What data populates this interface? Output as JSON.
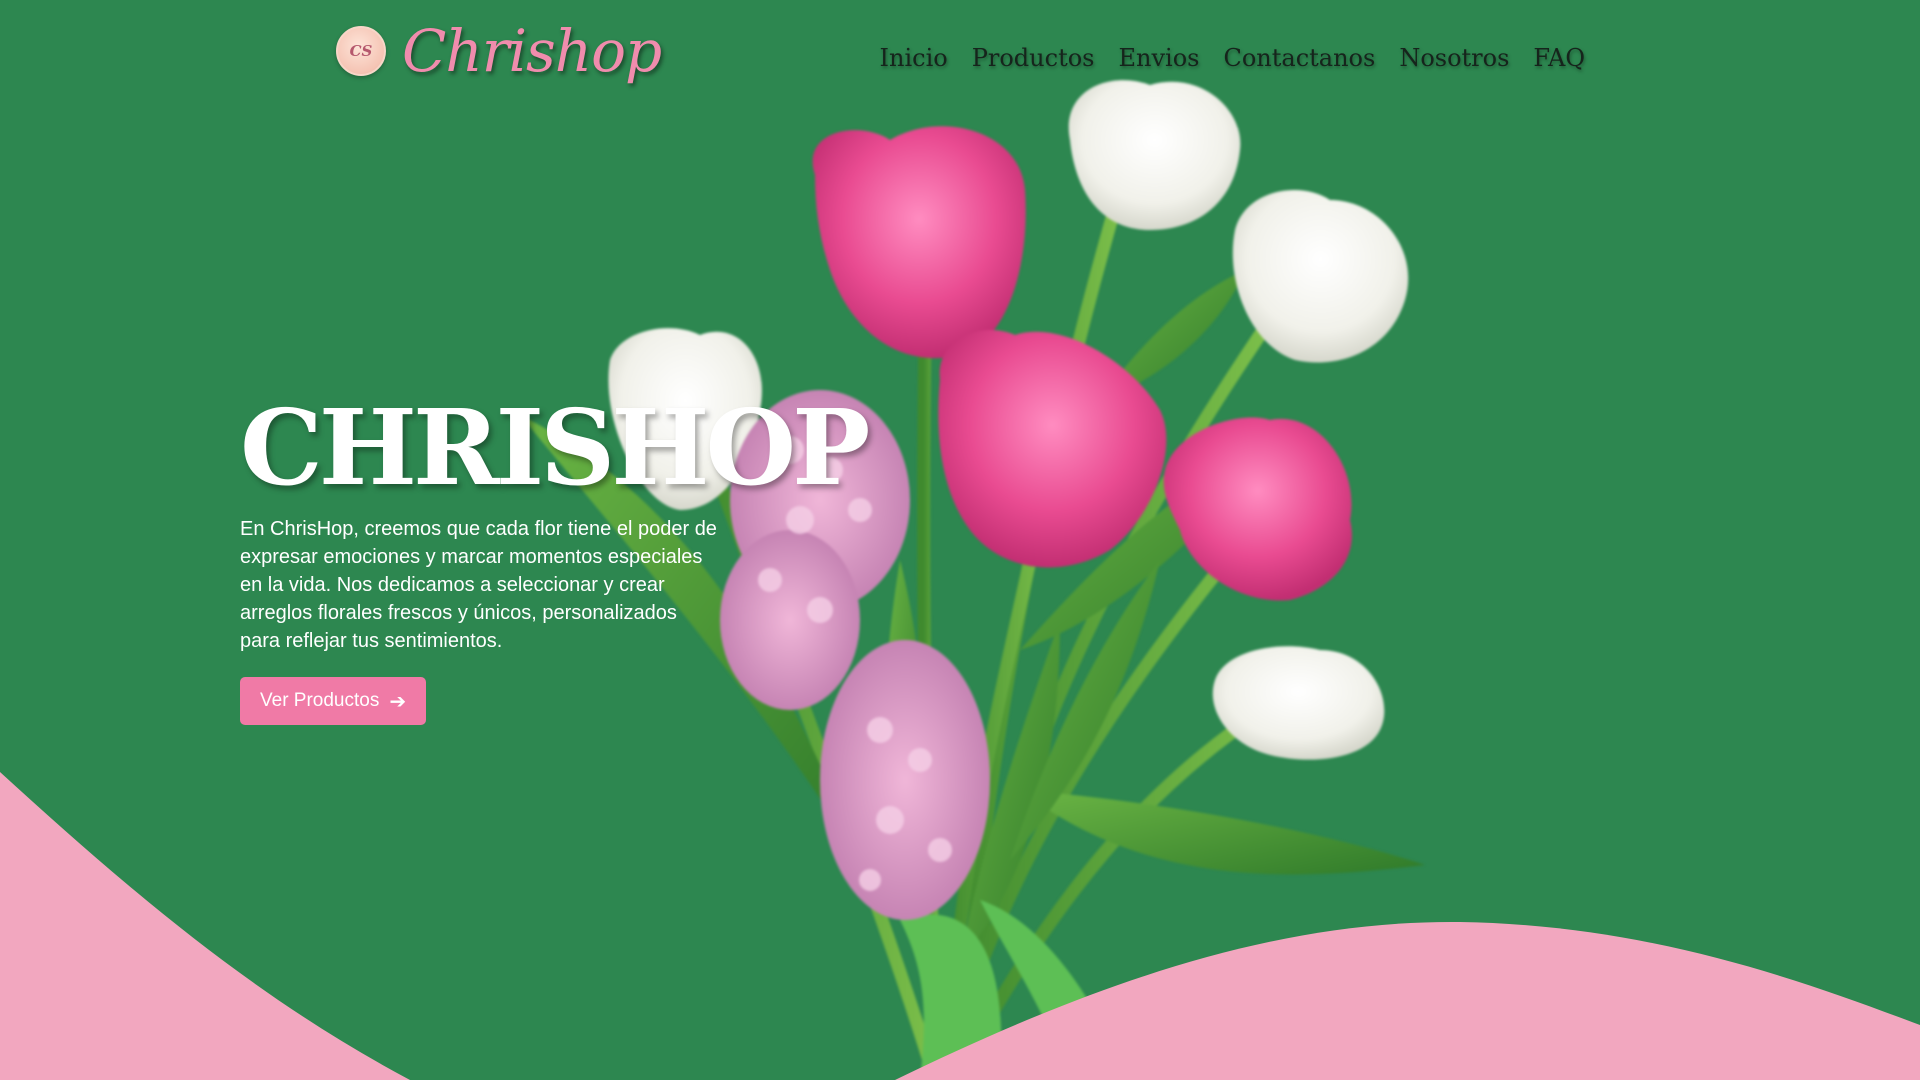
{
  "header": {
    "logo_monogram": "CS",
    "brand_name": "Chrishop",
    "nav": [
      {
        "label": "Inicio"
      },
      {
        "label": "Productos"
      },
      {
        "label": "Envios"
      },
      {
        "label": "Contactanos"
      },
      {
        "label": "Nosotros"
      },
      {
        "label": "FAQ"
      }
    ]
  },
  "hero": {
    "title": "CHRISHOP",
    "description": "En ChrisHop, creemos que cada flor tiene el poder de expresar emociones y marcar momentos especiales en la vida. Nos dedicamos a seleccionar y crear arreglos florales frescos y únicos, personalizados para reflejar tus sentimientos.",
    "cta_label": "Ver Productos",
    "cta_icon": "arrow-right-icon"
  },
  "colors": {
    "background": "#2d8750",
    "accent_pink": "#f07aa6",
    "wave_pink": "#f2a7bf",
    "brand_pink": "#f08cad",
    "nav_text": "#16241c"
  }
}
